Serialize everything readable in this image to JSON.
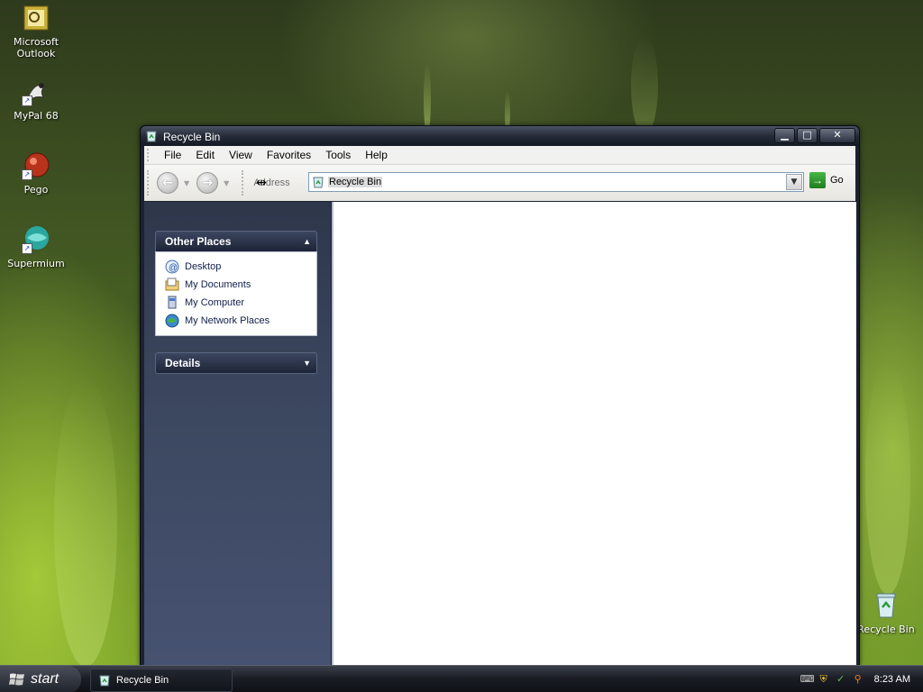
{
  "desktop": {
    "icons": [
      {
        "label": "Microsoft Outlook",
        "icon": "outlook-icon"
      },
      {
        "label": "MyPal 68",
        "icon": "mypal-icon"
      },
      {
        "label": "Pego",
        "icon": "pego-icon"
      },
      {
        "label": "Supermium",
        "icon": "supermium-icon"
      },
      {
        "label": "Recycle Bin",
        "icon": "recycle-bin-icon"
      }
    ]
  },
  "window": {
    "title": "Recycle Bin",
    "buttons": {
      "minimize": "▁",
      "maximize": "□",
      "close": "✕"
    },
    "menu": [
      "File",
      "Edit",
      "View",
      "Favorites",
      "Tools",
      "Help"
    ],
    "toolbar": {
      "back_icon": "back-arrow-icon",
      "forward_icon": "forward-arrow-icon",
      "address_label": "Address",
      "address_value": "Recycle Bin",
      "go_label": "Go"
    },
    "task_pane": {
      "other_places": {
        "header": "Other Places",
        "items": [
          {
            "label": "Desktop",
            "icon": "desktop-icon"
          },
          {
            "label": "My Documents",
            "icon": "my-documents-icon"
          },
          {
            "label": "My Computer",
            "icon": "my-computer-icon"
          },
          {
            "label": "My Network Places",
            "icon": "network-places-icon"
          }
        ]
      },
      "details": {
        "header": "Details"
      }
    }
  },
  "taskbar": {
    "start_label": "start",
    "task_items": [
      {
        "label": "Recycle Bin",
        "icon": "recycle-bin-icon"
      }
    ],
    "clock": "8:23 AM"
  },
  "colors": {
    "taskpane_bg": "#3b465e",
    "titlebar_bg": "#252b38",
    "go_green": "#1e7d1e",
    "taskbar_bg": "#1b1e25"
  }
}
